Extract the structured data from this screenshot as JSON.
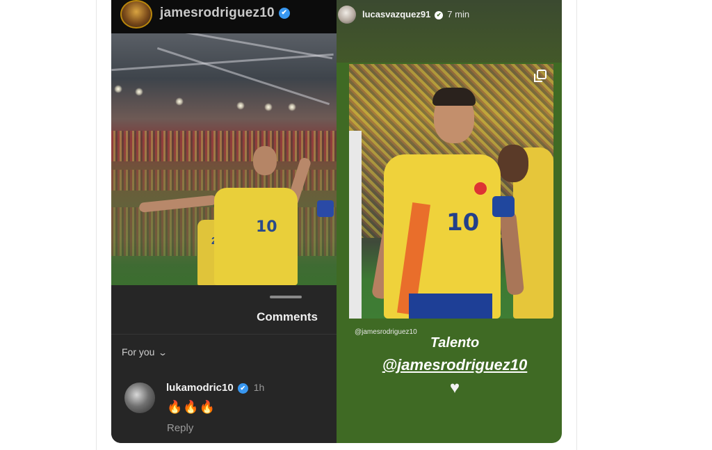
{
  "left_story": {
    "username": "jamesrodriguez10",
    "verified_glyph": "✔",
    "photo_jersey_number": "10",
    "photo_teammate_number": "21"
  },
  "comments_sheet": {
    "title": "Comments",
    "filter_label": "For you",
    "filter_chevron": "⌄",
    "comment": {
      "username": "lukamodric10",
      "verified_glyph": "✔",
      "time": "1h",
      "text": "🔥🔥🔥",
      "reply_label": "Reply"
    }
  },
  "right_story": {
    "username": "lucasvazquez91",
    "verified_glyph": "✔",
    "time": "7 min",
    "photo_jersey_number": "10",
    "small_mention": "@jamesrodriguez10",
    "caption": "Talento",
    "mention": "@jamesrodriguez10",
    "heart_glyph": "♥"
  },
  "icons": {
    "verified": "verified-badge-icon",
    "copy": "multiple-posts-icon",
    "chevron": "chevron-down-icon",
    "heart": "heart-icon"
  },
  "colors": {
    "verified_blue": "#3897f0",
    "story_green": "#3f6a24",
    "sheet_dark": "#262626",
    "jersey_yellow": "#efd23b"
  }
}
